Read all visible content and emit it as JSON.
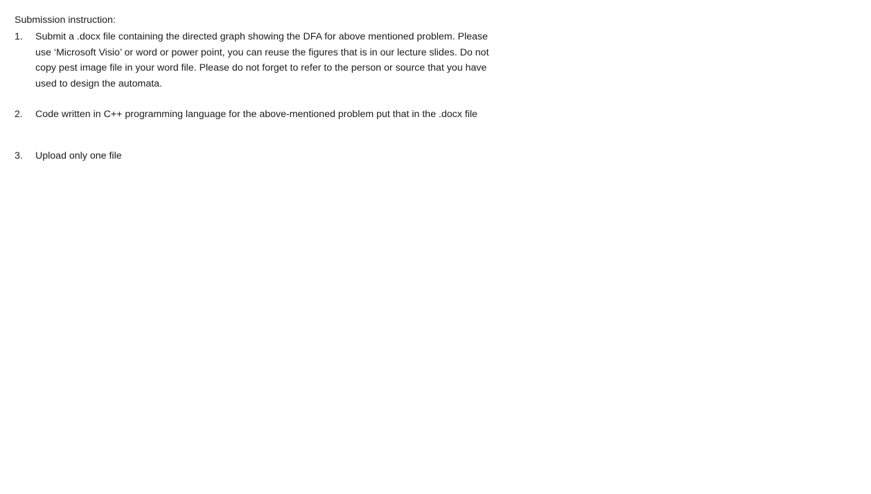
{
  "heading": "Submission instruction:",
  "items": [
    {
      "number": "1.",
      "lines": [
        "Submit a .docx file containing the directed graph showing the DFA for above mentioned problem. Please",
        "use ‘Microsoft Visio’ or word or power point, you can reuse the figures that is in our lecture slides. Do not",
        "copy pest image file in your word file.  Please do not forget to refer to the person or source that you have",
        "used to design the automata."
      ]
    },
    {
      "number": "2.",
      "lines": [
        "Code written in C++ programming language for the above-mentioned problem put that in the .docx file"
      ]
    },
    {
      "number": "3.",
      "lines": [
        "Upload only one file"
      ]
    }
  ]
}
